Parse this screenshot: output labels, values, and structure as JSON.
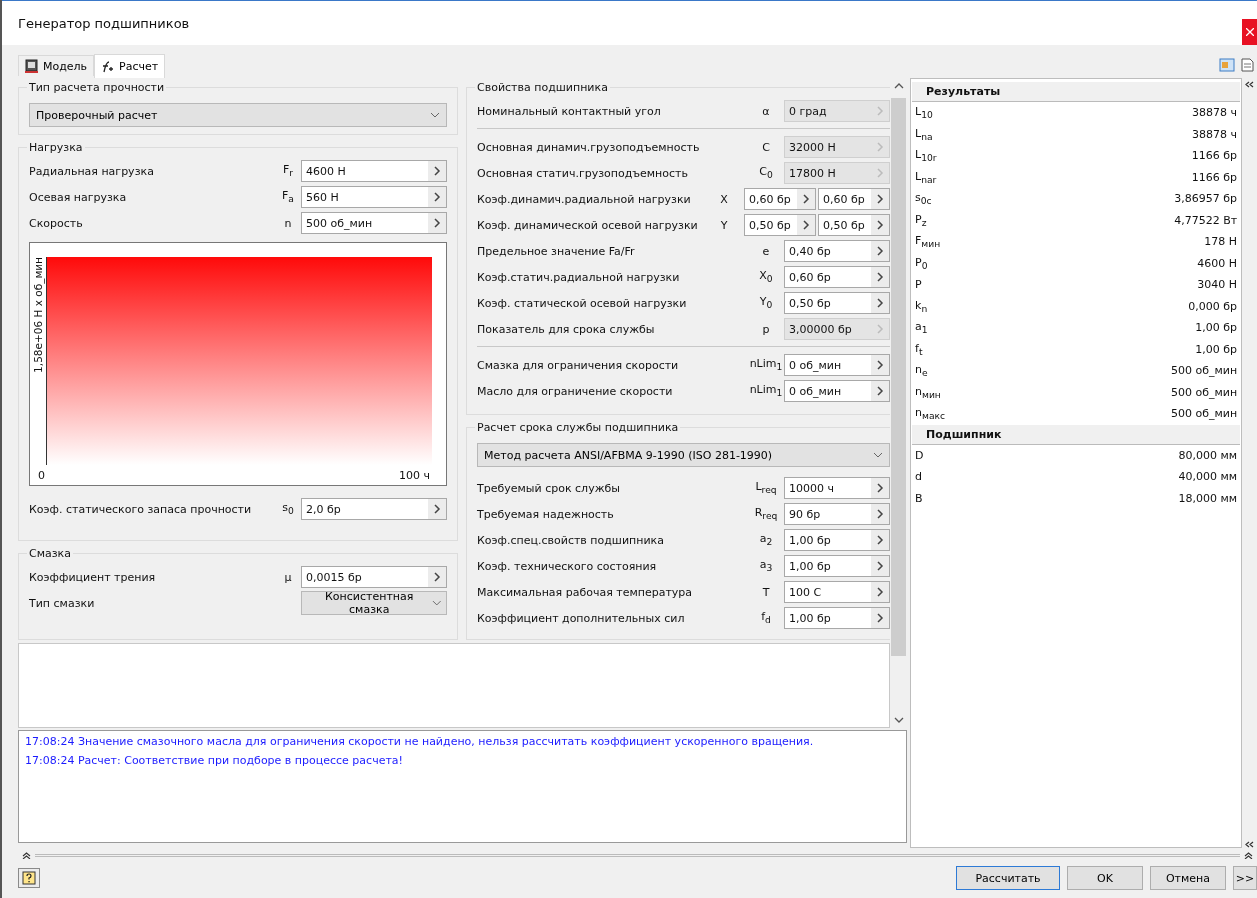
{
  "window": {
    "title": "Генератор подшипников"
  },
  "tabs": [
    {
      "label": "Модель",
      "selected": false
    },
    {
      "label": "Расчет",
      "selected": true
    }
  ],
  "strength": {
    "title": "Тип расчета прочности",
    "dropdown": "Проверочный расчет"
  },
  "load": {
    "title": "Нагрузка",
    "rows": [
      {
        "label": "Радиальная нагрузка",
        "symbol": "F$_{r}$",
        "value": "4600 Н"
      },
      {
        "label": "Осевая нагрузка",
        "symbol": "F$_{a}$",
        "value": "560 Н"
      },
      {
        "label": "Скорость",
        "symbol": "n",
        "value": "500 об_мин"
      }
    ],
    "chart": {
      "y_label": "1,58e+06 H x об_мин",
      "x_start": "0",
      "x_end": "100 ч"
    },
    "safety": {
      "label": "Коэф. статического запаса прочности",
      "symbol": "s$_{0}$",
      "value": "2,0 бр"
    }
  },
  "lubrication": {
    "title": "Смазка",
    "rows": [
      {
        "kind": "input",
        "label": "Коэффициент трения",
        "symbol": "μ",
        "value": "0,0015 бр"
      },
      {
        "kind": "dropdown",
        "label": "Тип смазки",
        "value": "Консистентная смазка"
      }
    ]
  },
  "bearing_properties": {
    "title": "Свойства подшипника",
    "rows": [
      {
        "kind": "single",
        "label": "Номинальный контактный угол",
        "symbol": "α",
        "value": "0 град",
        "disabled": true
      },
      {
        "kind": "separator"
      },
      {
        "kind": "single",
        "label": "Основная динамич.грузоподъемность",
        "symbol": "C",
        "value": "32000 Н",
        "disabled": true
      },
      {
        "kind": "single",
        "label": "Основная статич.грузоподъемность",
        "symbol": "C$_{0}$",
        "value": "17800 Н",
        "disabled": true
      },
      {
        "kind": "double",
        "label": "Коэф.динамич.радиальной нагрузки",
        "symbol": "X",
        "values": [
          "0,60 бр",
          "0,60 бр"
        ],
        "disabled": false
      },
      {
        "kind": "double",
        "label": "Коэф. динамической осевой нагрузки",
        "symbol": "Y",
        "values": [
          "0,50 бр",
          "0,50 бр"
        ],
        "disabled": false
      },
      {
        "kind": "single",
        "label": "Предельное значение Fa/Fr",
        "symbol": "e",
        "value": "0,40 бр",
        "disabled": false
      },
      {
        "kind": "single",
        "label": "Коэф.статич.радиальной нагрузки",
        "symbol": "X$_{0}$",
        "value": "0,60 бр",
        "disabled": false
      },
      {
        "kind": "single",
        "label": "Коэф. статической осевой нагрузки",
        "symbol": "Y$_{0}$",
        "value": "0,50 бр",
        "disabled": false
      },
      {
        "kind": "single",
        "label": "Показатель для срока службы",
        "symbol": "p",
        "value": "3,00000 бр",
        "disabled": true
      },
      {
        "kind": "separator"
      },
      {
        "kind": "single",
        "label": "Смазка для ограничения скорости",
        "symbol": "nLim$_{1}$",
        "value": "0 об_мин",
        "disabled": false
      },
      {
        "kind": "single",
        "label": "Масло для ограничение скорости",
        "symbol": "nLim$_{1}$",
        "value": "0 об_мин",
        "disabled": false
      }
    ]
  },
  "life": {
    "title": "Расчет срока службы подшипника",
    "dropdown": "Метод расчета ANSI/AFBMA 9-1990 (ISO 281-1990)",
    "rows": [
      {
        "label": "Требуемый срок службы",
        "symbol": "L$_{req}$",
        "value": "10000 ч"
      },
      {
        "label": "Требуемая надежность",
        "symbol": "R$_{req}$",
        "value": "90 бр"
      },
      {
        "label": "Коэф.спец.свойств подшипника",
        "symbol": "a$_{2}$",
        "value": "1,00 бр"
      },
      {
        "label": "Коэф. технического состояния",
        "symbol": "a$_{3}$",
        "value": "1,00 бр"
      },
      {
        "label": "Максимальная рабочая температура",
        "symbol": "T",
        "value": "100 C"
      },
      {
        "label": "Коэффициент дополнительных сил",
        "symbol": "f$_{d}$",
        "value": "1,00 бр"
      }
    ]
  },
  "results": [
    {
      "title": "Результаты",
      "rows": [
        {
          "symbol": "L$_{10}$",
          "value": "38878 ч"
        },
        {
          "symbol": "L$_{na}$",
          "value": "38878 ч"
        },
        {
          "symbol": "L$_{10r}$",
          "value": "1166 бр"
        },
        {
          "symbol": "L$_{nar}$",
          "value": "1166 бр"
        },
        {
          "symbol": "s$_{0c}$",
          "value": "3,86957 бр"
        },
        {
          "symbol": "P$_{z}$",
          "value": "4,77522 Вт"
        },
        {
          "symbol": "F$_{мин}$",
          "value": "178 Н"
        },
        {
          "symbol": "P$_{0}$",
          "value": "4600 Н"
        },
        {
          "symbol": "P",
          "value": "3040 Н"
        },
        {
          "symbol": "k$_{n}$",
          "value": "0,000 бр"
        },
        {
          "symbol": "a$_{1}$",
          "value": "1,00 бр"
        },
        {
          "symbol": "f$_{t}$",
          "value": "1,00 бр"
        },
        {
          "symbol": "n$_{e}$",
          "value": "500 об_мин"
        },
        {
          "symbol": "n$_{мин}$",
          "value": "500 об_мин"
        },
        {
          "symbol": "n$_{макс}$",
          "value": "500 об_мин"
        }
      ]
    },
    {
      "title": "Подшипник",
      "rows": [
        {
          "symbol": "D",
          "value": "80,000 мм"
        },
        {
          "symbol": "d",
          "value": "40,000 мм"
        },
        {
          "symbol": "B",
          "value": "18,000 мм"
        }
      ]
    }
  ],
  "log": [
    "17:08:24 Значение смазочного масла для ограничения скорости не найдено, нельзя рассчитать коэффициент ускоренного вращения.",
    "17:08:24 Расчет: Соответствие при подборе в процессе расчета!"
  ],
  "buttons": [
    {
      "label": "Рассчитать",
      "default": true
    },
    {
      "label": "OK",
      "default": false
    },
    {
      "label": "Отмена",
      "default": false
    },
    {
      "label": ">>",
      "default": false
    }
  ]
}
